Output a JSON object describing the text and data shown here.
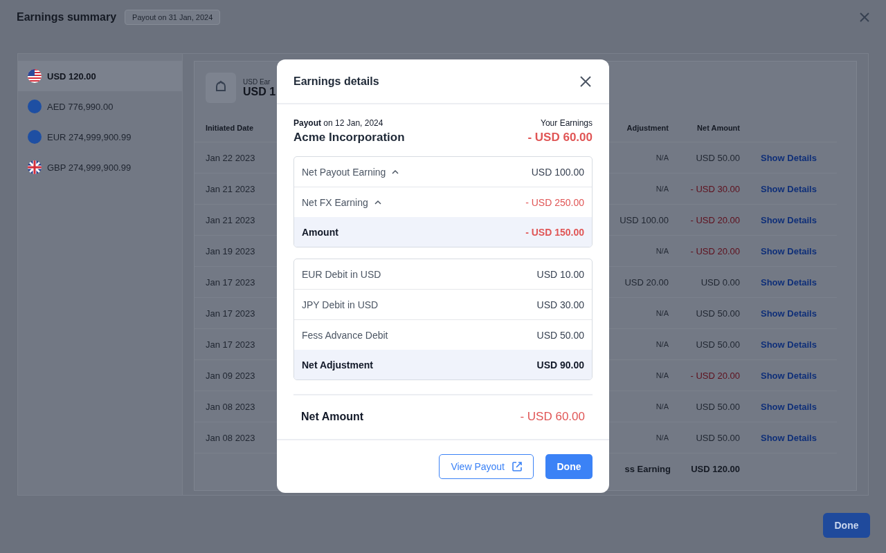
{
  "background": {
    "title": "Earnings summary",
    "badge": "Payout on 31 Jan, 2024",
    "currencies": [
      {
        "label": "USD 120.00",
        "selected": true,
        "kind": "us"
      },
      {
        "label": "AED 776,990.00",
        "selected": false,
        "kind": "plain"
      },
      {
        "label": "EUR 274,999,900.99",
        "selected": false,
        "kind": "plain"
      },
      {
        "label": "GBP 274,999,900.99",
        "selected": false,
        "kind": "uk"
      }
    ],
    "summary": {
      "label": "USD Ear",
      "value": "USD 1"
    },
    "table": {
      "columns": [
        "Initiated Date",
        "Adjustment",
        "Net Amount"
      ],
      "rows": [
        {
          "date": "Jan 22 2023",
          "adjustment": "N/A",
          "net": "USD 50.00",
          "negative": false,
          "action": "Show Details"
        },
        {
          "date": "Jan 21 2023",
          "adjustment": "N/A",
          "net": "- USD 30.00",
          "negative": true,
          "action": "Show Details"
        },
        {
          "date": "Jan 21 2023",
          "adjustment": "USD 100.00",
          "net": "- USD 20.00",
          "negative": true,
          "action": "Show Details"
        },
        {
          "date": "Jan 19 2023",
          "adjustment": "N/A",
          "net": "- USD 20.00",
          "negative": true,
          "action": "Show Details"
        },
        {
          "date": "Jan 17 2023",
          "adjustment": "USD 20.00",
          "net": "USD 0.00",
          "negative": false,
          "action": "Show Details"
        },
        {
          "date": "Jan 17 2023",
          "adjustment": "N/A",
          "net": "USD 50.00",
          "negative": false,
          "action": "Show Details"
        },
        {
          "date": "Jan 17 2023",
          "adjustment": "N/A",
          "net": "USD 50.00",
          "negative": false,
          "action": "Show Details"
        },
        {
          "date": "Jan 09 2023",
          "adjustment": "N/A",
          "net": "- USD 20.00",
          "negative": true,
          "action": "Show Details"
        },
        {
          "date": "Jan 08 2023",
          "adjustment": "N/A",
          "net": "USD 50.00",
          "negative": false,
          "action": "Show Details"
        },
        {
          "date": "Jan 08 2023",
          "adjustment": "N/A",
          "net": "USD 50.00",
          "negative": false,
          "action": "Show Details"
        }
      ],
      "footer": {
        "label": "ss Earning",
        "value": "USD 120.00"
      }
    },
    "done_button": "Done"
  },
  "modal": {
    "title": "Earnings details",
    "payout_line": "**Payout** on 12 Jan, 2024",
    "earnings_label": "Your Earnings",
    "company": "Acme Incorporation",
    "earnings": {
      "value": "- USD 60.00",
      "negative": true
    },
    "groups": [
      {
        "rows": [
          {
            "kind": "expandable",
            "label": "Net Payout Earning",
            "value": "USD 100.00",
            "negative": false,
            "expanded": true
          },
          {
            "kind": "expandable",
            "label": "Net FX Earning",
            "value": "- USD 250.00",
            "negative": true,
            "expanded": true
          },
          {
            "kind": "total",
            "label": "Amount",
            "value": "- USD 150.00",
            "negative": true
          }
        ]
      },
      {
        "rows": [
          {
            "kind": "item",
            "label": "EUR Debit in USD",
            "value": "USD 10.00",
            "negative": false
          },
          {
            "kind": "item",
            "label": "JPY Debit in USD",
            "value": "USD 30.00",
            "negative": false
          },
          {
            "kind": "item",
            "label": "Fess Advance Debit",
            "value": "USD 50.00",
            "negative": false
          },
          {
            "kind": "total",
            "label": "Net Adjustment",
            "value": "USD 90.00",
            "negative": false
          }
        ]
      }
    ],
    "net_amount": {
      "label": "Net Amount",
      "value": "- USD 60.00",
      "negative": true
    },
    "buttons": {
      "view": "View Payout",
      "done": "Done"
    }
  }
}
